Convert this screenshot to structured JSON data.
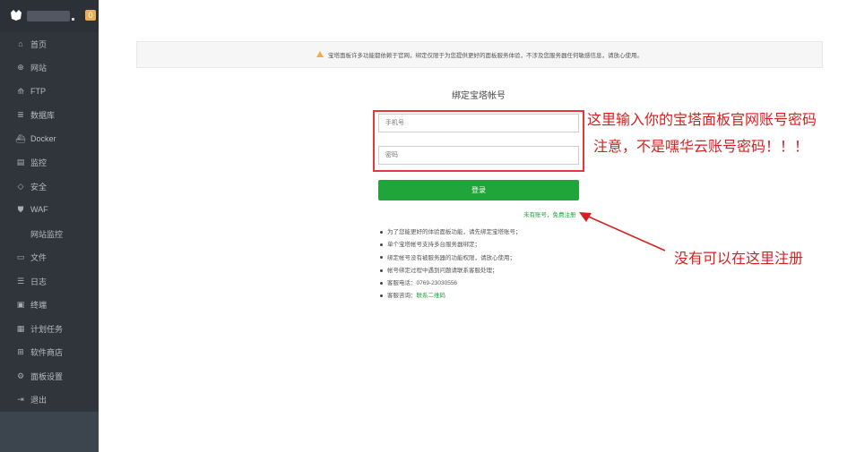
{
  "sidebar": {
    "badge": "0",
    "items": [
      {
        "icon": "home-icon",
        "glyph": "⌂",
        "label": "首页"
      },
      {
        "icon": "globe-icon",
        "glyph": "⊕",
        "label": "网站"
      },
      {
        "icon": "ftp-icon",
        "glyph": "⟰",
        "label": "FTP"
      },
      {
        "icon": "database-icon",
        "glyph": "≣",
        "label": "数据库"
      },
      {
        "icon": "docker-icon",
        "glyph": "⛴",
        "label": "Docker"
      },
      {
        "icon": "monitor-icon",
        "glyph": "▤",
        "label": "监控"
      },
      {
        "icon": "shield-icon",
        "glyph": "◇",
        "label": "安全"
      },
      {
        "icon": "waf-icon",
        "glyph": "⛊",
        "label": "WAF"
      },
      {
        "icon": "",
        "glyph": "",
        "label": "网站监控"
      },
      {
        "icon": "folder-icon",
        "glyph": "▭",
        "label": "文件"
      },
      {
        "icon": "log-icon",
        "glyph": "☰",
        "label": "日志"
      },
      {
        "icon": "terminal-icon",
        "glyph": "▣",
        "label": "终端"
      },
      {
        "icon": "calendar-icon",
        "glyph": "▦",
        "label": "计划任务"
      },
      {
        "icon": "store-icon",
        "glyph": "⊞",
        "label": "软件商店"
      },
      {
        "icon": "gear-icon",
        "glyph": "⚙",
        "label": "面板设置"
      },
      {
        "icon": "logout-icon",
        "glyph": "⇥",
        "label": "退出"
      }
    ]
  },
  "notice": "宝塔面板许多功能都依赖于官网，绑定仅限于为您提供更好的面板服务体验，不涉及您服务器任何敏感信息，请放心使用。",
  "form": {
    "title": "绑定宝塔帐号",
    "phone_placeholder": "手机号",
    "password_placeholder": "密码",
    "login_label": "登录",
    "register_link": "未有账号，免费注册"
  },
  "tips": [
    "为了您能更好的体验面板功能，请先绑定宝塔账号；",
    "单个宝塔帐号支持多台服务器绑定；",
    "绑定帐号没有被服务器的功能权限，请放心使用；",
    "帐号绑定过程中遇到问题请联系客服处理；",
    "客服电话：0769-23030556"
  ],
  "consult": {
    "label": "客服咨询：",
    "link": "联系二维码"
  },
  "annotations": {
    "top": "这里输入你的宝塔面板官网账号密码",
    "warning": "注意，不是嘿华云账号密码！！！",
    "register": "没有可以在这里注册"
  },
  "colors": {
    "brand_green": "#20a53a",
    "annotation_red": "#d61f1f",
    "sidebar": "#2f353b"
  }
}
